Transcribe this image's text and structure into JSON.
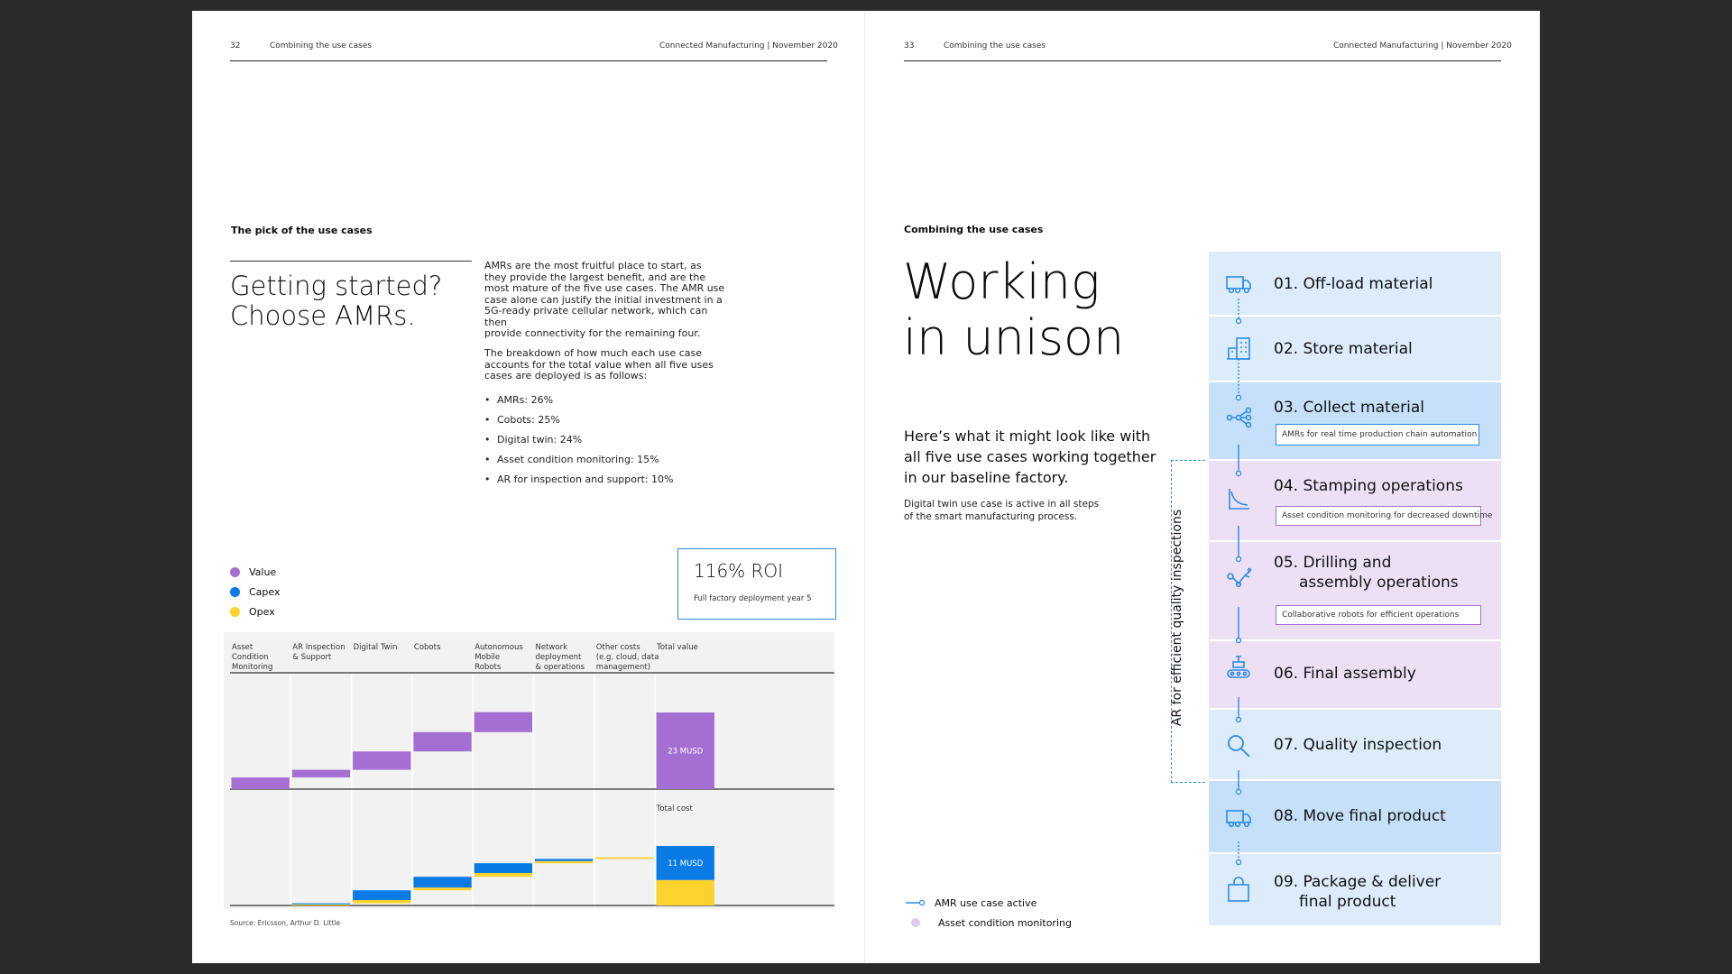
{
  "left_page": {
    "page_number": "32",
    "section": "Combining the use cases",
    "publication": "Connected Manufacturing  |  November 2020",
    "kicker": "The pick of the use cases",
    "headline_line1": "Getting started?",
    "headline_line2": "Choose AMRs.",
    "para1_lines": [
      "AMRs are the most fruitful place to start, as",
      "they provide the largest benefit, and are the",
      "most mature of the five use cases. The AMR use",
      "case alone can justify the initial investment in a",
      "5G-ready private cellular network, which can then",
      "provide connectivity for the remaining four."
    ],
    "para2_lines": [
      "The breakdown of how much each use case",
      "accounts for the total value when all five uses",
      "cases are deployed is as follows:"
    ],
    "bullets": [
      "AMRs: 26%",
      "Cobots: 25%",
      "Digital twin: 24%",
      "Asset condition monitoring: 15%",
      "AR for inspection and support: 10%"
    ],
    "source": "Source: Ericsson, Arthur D. Little"
  },
  "roi": {
    "value": "116% ROI",
    "caption": "Full factory deployment year 5"
  },
  "colors": {
    "value": "#a56ed3",
    "capex": "#0a7be4",
    "opex": "#fcd22d",
    "accent_blue": "#2c8be4",
    "panel_blue_light": "#dcecfa",
    "panel_blue_mid": "#c5e0f8",
    "panel_purple": "#ede0f4"
  },
  "chart_data": {
    "type": "bar",
    "subtype": "waterfall",
    "legend": [
      "Value",
      "Capex",
      "Opex"
    ],
    "categories": [
      "Asset Condition Monitoring",
      "AR Inspection & Support",
      "Digital Twin",
      "Cobots",
      "Autonomous Mobile Robots",
      "Network deployment & operations",
      "Other costs (e.g. cloud, data management)",
      "Total value"
    ],
    "category_labels": [
      [
        "Asset",
        "Condition",
        "Monitoring"
      ],
      [
        "AR Inspection",
        "& Support"
      ],
      [
        "Digital Twin"
      ],
      [
        "Cobots"
      ],
      [
        "Autonomous",
        "Mobile",
        "Robots"
      ],
      [
        "Network",
        "deployment",
        "& operations"
      ],
      [
        "Other costs",
        "(e.g. cloud, data",
        "management)"
      ],
      [
        "Total value"
      ]
    ],
    "value_axis_max": 23,
    "cost_axis_max": 11,
    "series": [
      {
        "name": "Value",
        "values": [
          3.5,
          2.3,
          5.5,
          5.8,
          6.0,
          0,
          0,
          23
        ]
      },
      {
        "name": "Capex",
        "values": [
          0,
          0.2,
          1.8,
          2.0,
          1.8,
          0.4,
          0,
          6.3
        ]
      },
      {
        "name": "Opex",
        "values": [
          0,
          0.2,
          0.6,
          0.5,
          0.7,
          0.4,
          0.3,
          4.7
        ]
      }
    ],
    "total_value_label": "23 MUSD",
    "total_cost_heading": "Total cost",
    "total_cost_label": "11 MUSD"
  },
  "right_page": {
    "page_number": "33",
    "section": "Combining the use cases",
    "publication": "Connected Manufacturing  |  November 2020",
    "kicker": "Combining the use cases",
    "title_line1": "Working",
    "title_line2": "in unison",
    "lead_lines": [
      "Here’s what it might look like with",
      "all five use cases working together",
      "in our baseline factory."
    ],
    "note_lines": [
      "Digital twin use case is active in all steps",
      "of the smart manufacturing process."
    ],
    "ar_bracket_label": "AR for efficient quality inspections",
    "legend": [
      {
        "label": "AMR use case active",
        "icon": "line-node-icon"
      },
      {
        "label": "Asset condition monitoring",
        "icon": "purple-dot-icon"
      }
    ]
  },
  "steps": [
    {
      "title": "01. Off-load material",
      "icon": "truck-icon",
      "shade": "light"
    },
    {
      "title": "02. Store material",
      "icon": "warehouse-icon",
      "shade": "light"
    },
    {
      "title": "03. Collect material",
      "icon": "network-nodes-icon",
      "shade": "mid",
      "sub": "AMRs for real time production chain automation"
    },
    {
      "title": "04. Stamping operations",
      "icon": "press-curve-icon",
      "shade": "purple",
      "sub": "Asset condition monitoring for decreased downtime"
    },
    {
      "title_lines": [
        "05. Drilling and",
        "assembly operations"
      ],
      "icon": "robot-arm-icon",
      "shade": "purple",
      "sub": "Collaborative robots for efficient operations"
    },
    {
      "title": "06. Final assembly",
      "icon": "conveyor-icon",
      "shade": "purple"
    },
    {
      "title": "07. Quality inspection",
      "icon": "magnifier-icon",
      "shade": "light"
    },
    {
      "title": "08. Move final product",
      "icon": "truck-icon",
      "shade": "mid"
    },
    {
      "title_lines": [
        "09. Package & deliver",
        "final product"
      ],
      "icon": "shopping-bag-icon",
      "shade": "light"
    }
  ]
}
